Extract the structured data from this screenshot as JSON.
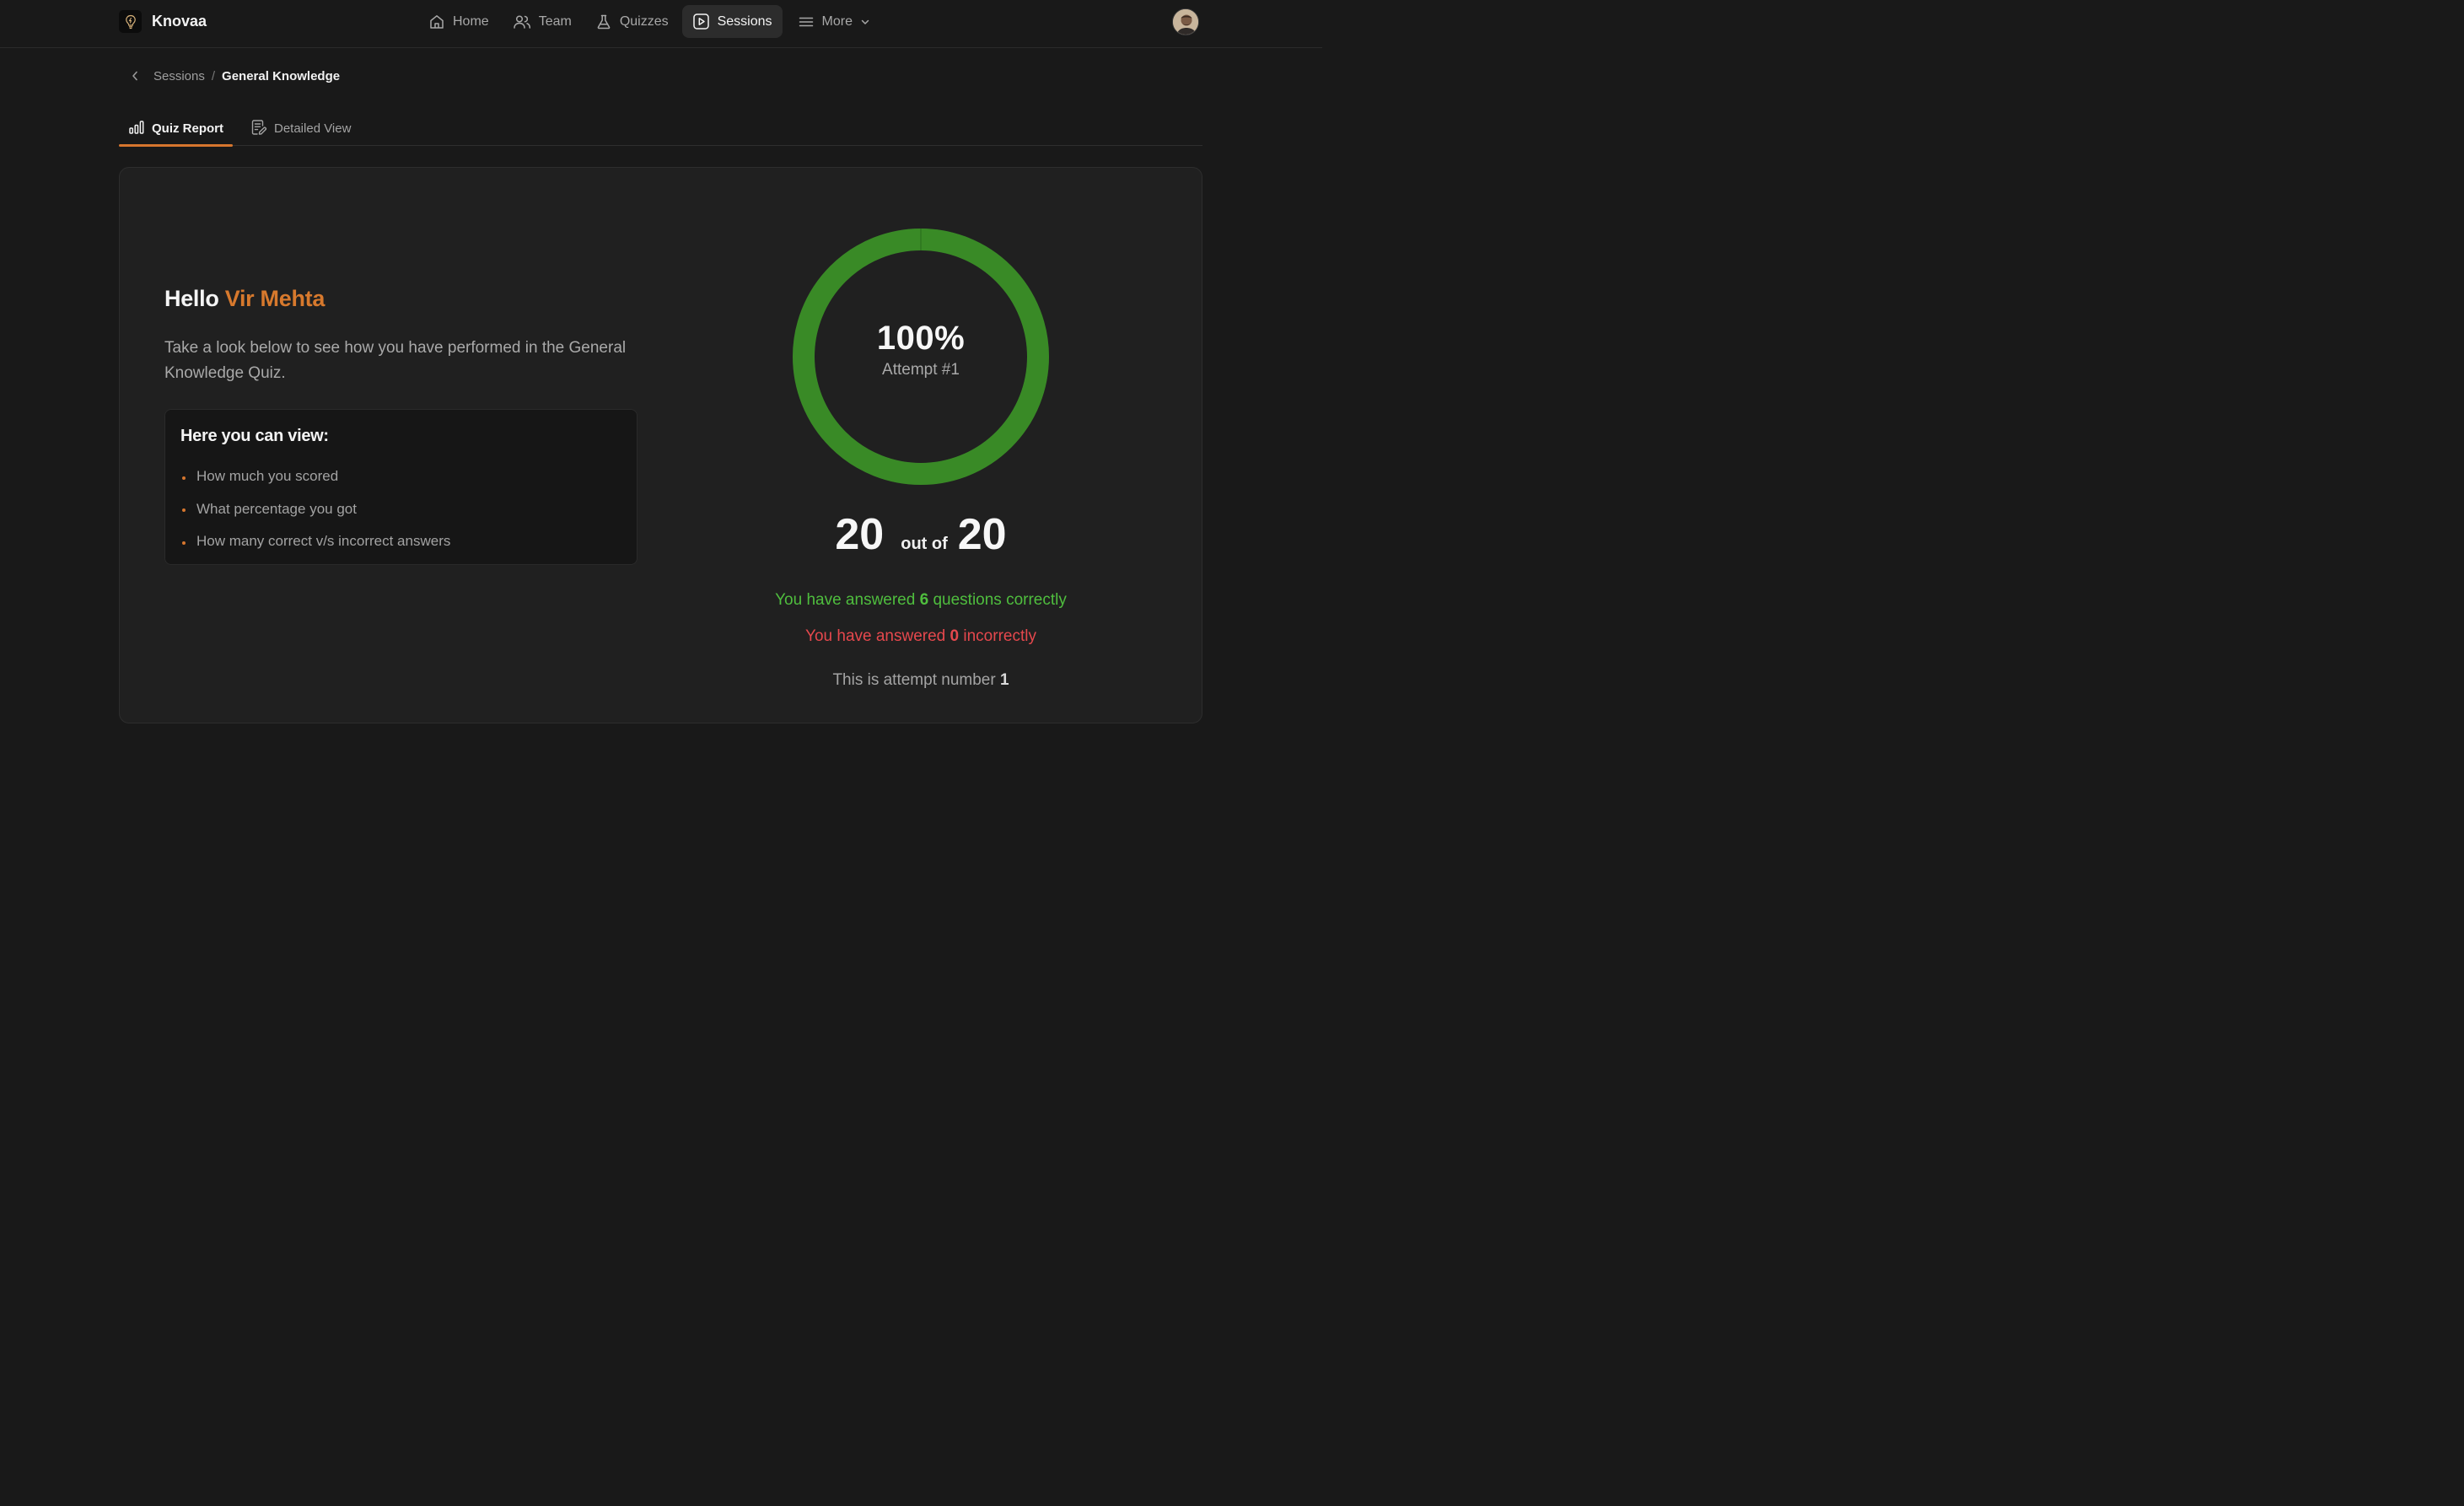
{
  "brand": {
    "name": "Knovaa"
  },
  "nav": {
    "items": [
      {
        "label": "Home",
        "icon": "home-icon"
      },
      {
        "label": "Team",
        "icon": "users-icon"
      },
      {
        "label": "Quizzes",
        "icon": "flask-icon"
      },
      {
        "label": "Sessions",
        "icon": "play-square-icon",
        "active": true
      },
      {
        "label": "More",
        "icon": "menu-icon"
      }
    ]
  },
  "breadcrumb": {
    "parent": "Sessions",
    "separator": "/",
    "current": "General Knowledge"
  },
  "tabs": [
    {
      "label": "Quiz Report",
      "icon": "bar-chart-icon",
      "active": true
    },
    {
      "label": "Detailed View",
      "icon": "document-edit-icon",
      "active": false
    }
  ],
  "report": {
    "greeting": "Hello",
    "user_name": "Vir Mehta",
    "intro": "Take a look below to see how you have performed in the General Knowledge Quiz.",
    "info_title": "Here you can view:",
    "info_items": [
      "How much you scored",
      "What percentage you got",
      "How many correct v/s incorrect answers"
    ],
    "percentage": "100%",
    "percentage_value": 100,
    "attempt_label": "Attempt #1",
    "score": "20",
    "out_of_label": "out of",
    "total": "20",
    "correct_prefix": "You have answered",
    "correct_count": "6",
    "correct_suffix": "questions correctly",
    "incorrect_prefix": "You have answered",
    "incorrect_count": "0",
    "incorrect_suffix": "incorrectly",
    "attempt_prefix": "This is attempt number",
    "attempt_number": "1"
  },
  "colors": {
    "accent": "#d6762e",
    "success": "#4fbe3e",
    "ring": "#398a26",
    "danger": "#e5484d",
    "background": "#191919",
    "card": "#202020"
  }
}
